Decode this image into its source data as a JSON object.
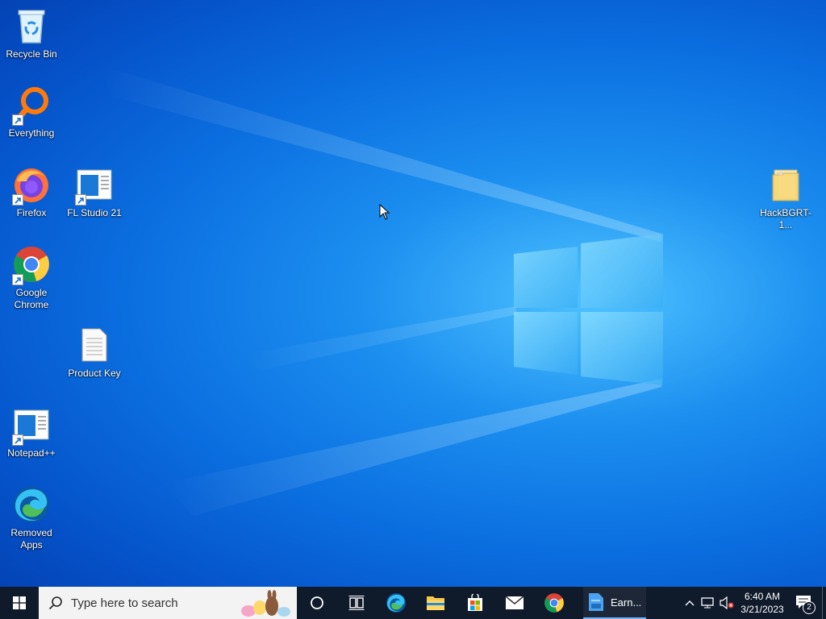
{
  "desktop": {
    "icons": [
      {
        "label": "Recycle Bin"
      },
      {
        "label": "Everything"
      },
      {
        "label": "Firefox"
      },
      {
        "label": "FL Studio 21"
      },
      {
        "label": "Google Chrome"
      },
      {
        "label": "Product Key"
      },
      {
        "label": "Notepad++"
      },
      {
        "label": "Removed Apps"
      },
      {
        "label": "HackBGRT-1..."
      }
    ]
  },
  "taskbar": {
    "search_placeholder": "Type here to search",
    "pinned": [
      "cortana-icon",
      "task-view-icon",
      "edge-icon",
      "file-explorer-icon",
      "store-icon",
      "mail-icon",
      "chrome-icon"
    ],
    "active_app_label": "Earn...",
    "clock": {
      "time": "6:40 AM",
      "date": "3/21/2023"
    },
    "notification_count": "2"
  },
  "colors": {
    "taskbar_bg": "#0f1a2b",
    "desktop_accent": "#0b6fe0"
  }
}
